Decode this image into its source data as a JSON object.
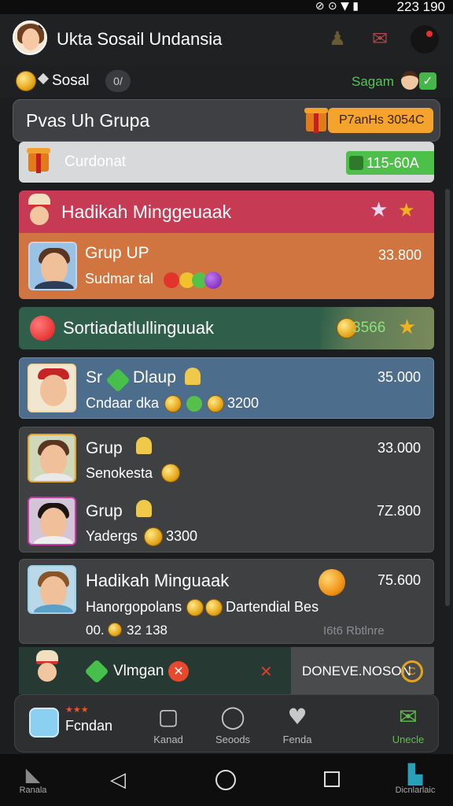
{
  "status_bar": {
    "time": "223 190",
    "icons": "⊘ ⊙ ▼ ▮"
  },
  "header": {
    "title": "Ukta Sosail Undansia"
  },
  "subheader": {
    "currency_label": "Sosal",
    "pill": "0/",
    "right_label": "Sagam",
    "check_icon": "✓"
  },
  "group_card": {
    "title": "Pvas Uh Grupa",
    "badge": "P7anHs 3054C"
  },
  "feed": {
    "gray": {
      "label": "Curdonat",
      "tag": "115-60A"
    },
    "pink": {
      "label": "Hadikah Minggeuaak",
      "star": "★"
    },
    "orange": {
      "name": "Grup UP",
      "sub": "Sudmar tal",
      "amount": "33.800"
    },
    "green": {
      "label": "Sortiadatlullinguuak",
      "amount": "3566",
      "star": "★"
    },
    "blue": {
      "name": "Sr",
      "name2": "Dlaup",
      "sub": "Cndaar dka",
      "sub_amount": "3200",
      "amount": "35.000"
    },
    "dark_rows": [
      {
        "name": "Grup",
        "sub": "Senokesta",
        "amount": "33.000"
      },
      {
        "name": "Grup",
        "sub": "Yadergs",
        "sub_amount": "3300",
        "amount": "7Z.800"
      }
    ],
    "weekly": {
      "name": "Hadikah Minguaak",
      "sub": "Hanorgopolans",
      "sub2": "Dartendial Bes",
      "meta_prefix": "00.",
      "meta": "32 138",
      "faint": "I6t6 Rbtlnre",
      "amount": "75.600"
    },
    "bottom": {
      "label": "Vlmgan",
      "right_label": "DONEVE.NOSON",
      "coin_symbol": "C",
      "x": "✕"
    }
  },
  "bottom_nav": {
    "home_label": "Fcndan",
    "home_stars": "★★★",
    "items": [
      {
        "label": "Kanad",
        "glyph": "▢"
      },
      {
        "label": "Seoods",
        "glyph": "◯"
      },
      {
        "label": "Fenda",
        "glyph": "♥"
      },
      {
        "label": "Unecle",
        "glyph": "✉"
      }
    ]
  },
  "system_nav": {
    "left_label": "Ranala",
    "right_label": "Dicnlarlaic",
    "back": "◁"
  },
  "colors": {
    "accent_green": "#4cc048",
    "pink": "#c63a54",
    "orange": "#d17540",
    "blue": "#4d6d8d",
    "gold": "#f4a32c"
  }
}
